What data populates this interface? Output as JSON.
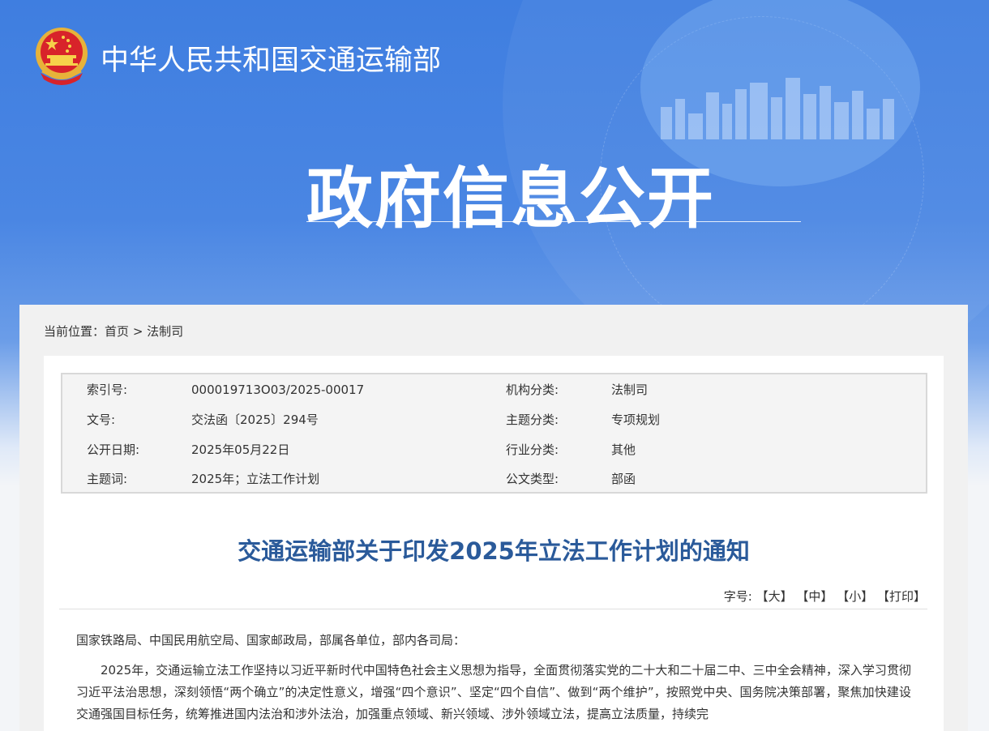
{
  "header": {
    "ministry_name": "中华人民共和国交通运输部",
    "section_title": "政府信息公开"
  },
  "breadcrumb": {
    "label": "当前位置：",
    "home": "首页",
    "separator": ">",
    "current": "法制司"
  },
  "meta": {
    "rows": [
      {
        "k1": "索引号:",
        "v1": "000019713O03/2025-00017",
        "k2": "机构分类:",
        "v2": "法制司"
      },
      {
        "k1": "文号:",
        "v1": "交法函〔2025〕294号",
        "k2": "主题分类:",
        "v2": "专项规划"
      },
      {
        "k1": "公开日期:",
        "v1": "2025年05月22日",
        "k2": "行业分类:",
        "v2": "其他"
      },
      {
        "k1": "主题词:",
        "v1": "2025年；立法工作计划",
        "k2": "公文类型:",
        "v2": "部函"
      }
    ]
  },
  "document": {
    "title": "交通运输部关于印发2025年立法工作计划的通知",
    "font_size_label": "字号:",
    "font_large": "【大】",
    "font_medium": "【中】",
    "font_small": "【小】",
    "print": "【打印】",
    "salutation": "国家铁路局、中国民用航空局、国家邮政局，部属各单位，部内各司局：",
    "paragraph1": "2025年，交通运输立法工作坚持以习近平新时代中国特色社会主义思想为指导，全面贯彻落实党的二十大和二十届二中、三中全会精神，深入学习贯彻习近平法治思想，深刻领悟“两个确立”的决定性意义，增强“四个意识”、坚定“四个自信”、做到“两个维护”，按照党中央、国务院决策部署，聚焦加快建设交通强国目标任务，统筹推进国内法治和涉外法治，加强重点领域、新兴领域、涉外领域立法，提高立法质量，持续完"
  },
  "colors": {
    "banner_blue": "#3f7ee0",
    "title_blue": "#2a5a9a"
  }
}
